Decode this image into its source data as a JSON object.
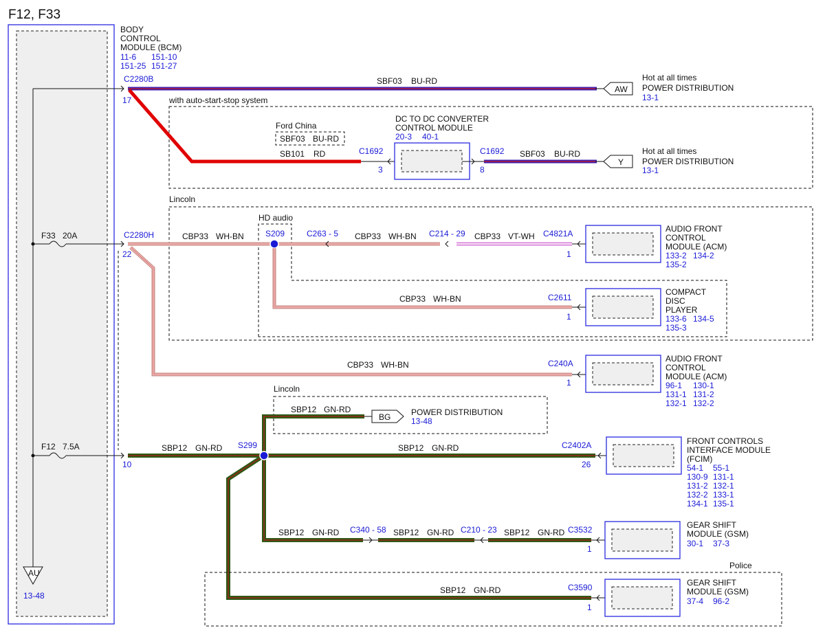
{
  "page_title": "F12, F33",
  "colors": {
    "bu_rd_wire": "#3b1fb0",
    "rd_wire": "#e00000",
    "gn_rd_wire": "#2e5a16",
    "gn_rd_core": "#b01a1a",
    "wh_bn_wire": "#c98a82",
    "vt_wh_wire": "#d87fd8",
    "module_border": "#2a2ae0",
    "link_text": "#1a1ad6"
  },
  "bcm": {
    "name_lines": [
      "BODY",
      "CONTROL",
      "MODULE (BCM)"
    ],
    "refs_row1": [
      "11-6",
      "151-10"
    ],
    "refs_row2": [
      "151-25",
      "151-27"
    ],
    "ground_label": "AU",
    "ground_ref": "13-48"
  },
  "fuses": {
    "f33": {
      "name": "F33",
      "rating": "20A"
    },
    "f12": {
      "name": "F12",
      "rating": "7.5A"
    }
  },
  "circuit_top": {
    "connector": "C2280B",
    "pin": "17",
    "wire_circuit": "SBF03",
    "wire_color": "BU-RD",
    "dest_tag": "AW",
    "dest_line1": "Hot at all times",
    "dest_line2": "POWER DISTRIBUTION",
    "dest_ref": "13-1"
  },
  "auto_start_stop": {
    "label": "with auto-start-stop system",
    "ford_china_label": "Ford China",
    "ford_china_circuit": "SBF03",
    "ford_china_color": "BU-RD",
    "wire_circuit": "SB101",
    "wire_color": "RD",
    "connector_in": "C1692",
    "pin_in": "3",
    "module_line1": "DC TO DC CONVERTER",
    "module_line2": "CONTROL MODULE",
    "module_refs": [
      "20-3",
      "40-1"
    ],
    "connector_out": "C1692",
    "pin_out": "8",
    "out_circuit": "SBF03",
    "out_color": "BU-RD",
    "dest_tag": "Y",
    "dest_line1": "Hot at all times",
    "dest_line2": "POWER DISTRIBUTION",
    "dest_ref": "13-1"
  },
  "audio": {
    "lincoln_label": "Lincoln",
    "hd_audio_label": "HD audio",
    "connector": "C2280H",
    "pin": "22",
    "wire1_circuit": "CBP33",
    "wire1_color": "WH-BN",
    "splice": "S209",
    "inline1": "C263 - 5",
    "wire2_circuit": "CBP33",
    "wire2_color": "WH-BN",
    "inline2": "C214 - 29",
    "wire3_circuit": "CBP33",
    "wire3_color": "VT-WH",
    "acm1_connector": "C4821A",
    "acm1_pin": "1",
    "acm1_lines": [
      "AUDIO FRONT",
      "CONTROL",
      "MODULE (ACM)"
    ],
    "acm1_refs_row1": [
      "133-2",
      "134-2"
    ],
    "acm1_refs_row2": [
      "135-2"
    ],
    "cd_circuit": "CBP33",
    "cd_color": "WH-BN",
    "cd_connector": "C2611",
    "cd_pin": "1",
    "cd_lines": [
      "COMPACT",
      "DISC",
      "PLAYER"
    ],
    "cd_refs_row1": [
      "133-6",
      "134-5"
    ],
    "cd_refs_row2": [
      "135-3"
    ],
    "acm2_circuit": "CBP33",
    "acm2_color": "WH-BN",
    "acm2_connector": "C240A",
    "acm2_pin": "1",
    "acm2_lines": [
      "AUDIO FRONT",
      "CONTROL",
      "MODULE (ACM)"
    ],
    "acm2_refs_row1": [
      "96-1",
      "130-1"
    ],
    "acm2_refs_row2": [
      "131-1",
      "131-2"
    ],
    "acm2_refs_row3": [
      "132-1",
      "132-2"
    ]
  },
  "gear": {
    "lincoln_label": "Lincoln",
    "bg_circuit": "SBP12",
    "bg_color": "GN-RD",
    "bg_tag": "BG",
    "bg_dest": "POWER DISTRIBUTION",
    "bg_ref": "13-48",
    "pin": "10",
    "main_circuit": "SBP12",
    "main_color": "GN-RD",
    "splice": "S299",
    "fcim_circuit": "SBP12",
    "fcim_color": "GN-RD",
    "fcim_connector": "C2402A",
    "fcim_pin": "26",
    "fcim_lines": [
      "FRONT CONTROLS",
      "INTERFACE MODULE",
      "(FCIM)"
    ],
    "fcim_refs": [
      [
        "54-1",
        "55-1"
      ],
      [
        "130-9",
        "131-1"
      ],
      [
        "131-2",
        "132-1"
      ],
      [
        "132-2",
        "133-1"
      ],
      [
        "134-1",
        "135-1"
      ]
    ],
    "gsm_seg1_circuit": "SBP12",
    "gsm_seg1_color": "GN-RD",
    "gsm_inline1": "C340 - 58",
    "gsm_seg2_circuit": "SBP12",
    "gsm_seg2_color": "GN-RD",
    "gsm_inline2": "C210 - 23",
    "gsm_seg3_circuit": "SBP12",
    "gsm_seg3_color": "GN-RD",
    "gsm_connector": "C3532",
    "gsm_pin": "1",
    "gsm_lines": [
      "GEAR SHIFT",
      "MODULE (GSM)"
    ],
    "gsm_refs": [
      "30-1",
      "37-3"
    ],
    "police_label": "Police",
    "pol_circuit": "SBP12",
    "pol_color": "GN-RD",
    "pol_connector": "C3590",
    "pol_pin": "1",
    "pol_lines": [
      "GEAR SHIFT",
      "MODULE (GSM)"
    ],
    "pol_refs": [
      "37-4",
      "96-2"
    ]
  }
}
